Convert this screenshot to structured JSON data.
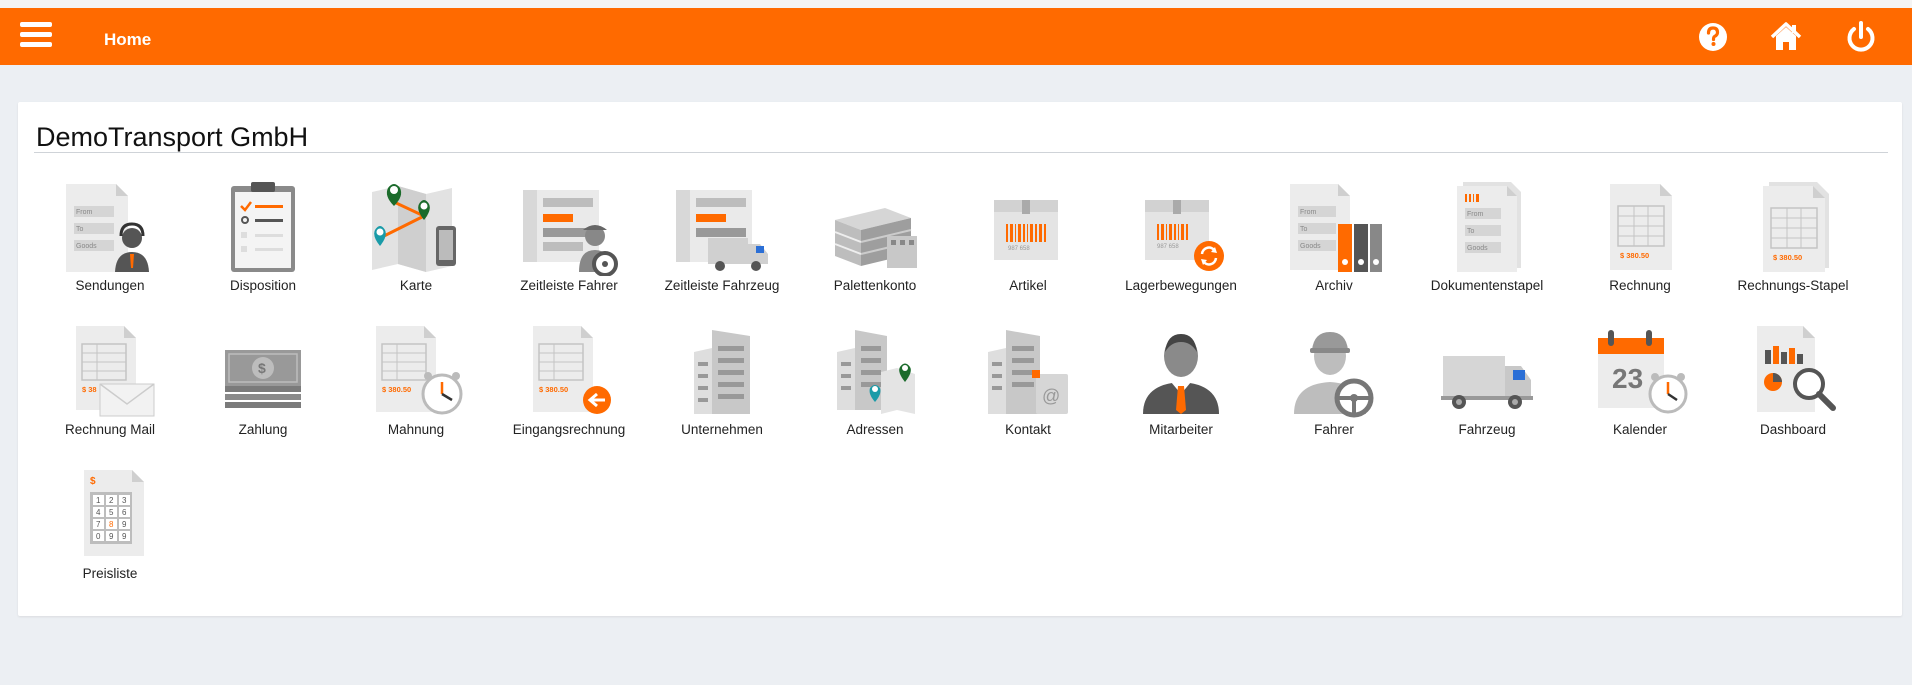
{
  "header": {
    "title": "Home",
    "icons": [
      "menu-icon",
      "help-icon",
      "home-icon",
      "power-icon"
    ]
  },
  "company": {
    "name": "DemoTransport GmbH"
  },
  "tiles": [
    {
      "label": "Sendungen",
      "icon": "shipments-icon"
    },
    {
      "label": "Disposition",
      "icon": "clipboard-icon"
    },
    {
      "label": "Karte",
      "icon": "map-icon"
    },
    {
      "label": "Zeitleiste Fahrer",
      "icon": "driver-timeline-icon"
    },
    {
      "label": "Zeitleiste Fahrzeug",
      "icon": "vehicle-timeline-icon"
    },
    {
      "label": "Palettenkonto",
      "icon": "pallets-icon"
    },
    {
      "label": "Artikel",
      "icon": "article-box-icon"
    },
    {
      "label": "Lagerbewegungen",
      "icon": "stock-movement-icon"
    },
    {
      "label": "Archiv",
      "icon": "archive-icon"
    },
    {
      "label": "Dokumentenstapel",
      "icon": "document-stack-icon"
    },
    {
      "label": "Rechnung",
      "icon": "invoice-icon"
    },
    {
      "label": "Rechnungs-Stapel",
      "icon": "invoice-stack-icon"
    },
    {
      "label": "Rechnung Mail",
      "icon": "invoice-mail-icon"
    },
    {
      "label": "Zahlung",
      "icon": "money-icon"
    },
    {
      "label": "Mahnung",
      "icon": "reminder-icon"
    },
    {
      "label": "Eingangsrechnung",
      "icon": "incoming-invoice-icon"
    },
    {
      "label": "Unternehmen",
      "icon": "company-building-icon"
    },
    {
      "label": "Adressen",
      "icon": "addresses-icon"
    },
    {
      "label": "Kontakt",
      "icon": "contact-icon"
    },
    {
      "label": "Mitarbeiter",
      "icon": "employee-icon"
    },
    {
      "label": "Fahrer",
      "icon": "driver-icon"
    },
    {
      "label": "Fahrzeug",
      "icon": "truck-icon"
    },
    {
      "label": "Kalender",
      "icon": "calendar-icon"
    },
    {
      "label": "Dashboard",
      "icon": "dashboard-icon"
    },
    {
      "label": "Preisliste",
      "icon": "pricelist-icon"
    }
  ],
  "icon_text": {
    "from": "From",
    "to": "To",
    "goods": "Goods",
    "amount": "$ 380.50",
    "amount_short": "$ 38",
    "barcode": "987 658",
    "calendar_day": "23",
    "dollar": "$",
    "at": "@",
    "keypad": [
      "1",
      "2",
      "3",
      "4",
      "5",
      "6",
      "7",
      "8",
      "9",
      "0",
      "9",
      "9"
    ]
  },
  "colors": {
    "accent": "#ff6a00",
    "background": "#eceff3",
    "card": "#ffffff"
  }
}
